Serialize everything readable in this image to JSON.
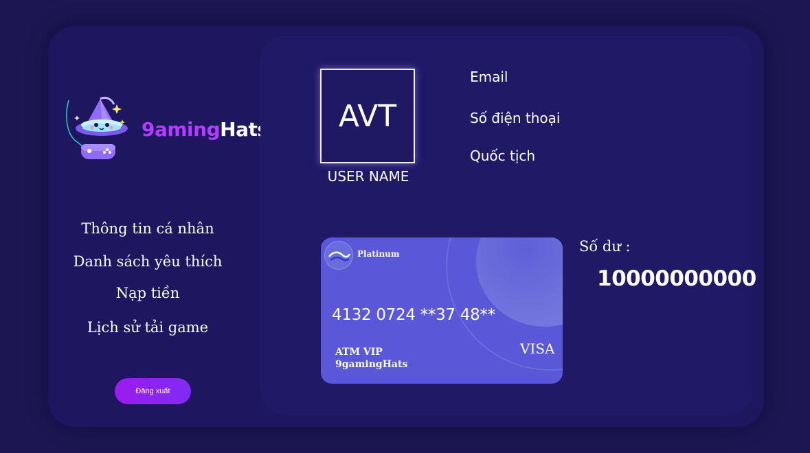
{
  "brand": {
    "logo_part1": "9aming",
    "logo_part2": "Hats"
  },
  "sidebar": {
    "menu": [
      {
        "label": "Thông tin cá nhân"
      },
      {
        "label": "Danh sách yêu thích"
      },
      {
        "label": "Nạp tiền"
      },
      {
        "label": "Lịch sử tải game"
      }
    ],
    "logout_label": "Đăng xuất"
  },
  "profile": {
    "avatar_text": "AVT",
    "username": "USER NAME",
    "email_label": "Email",
    "phone_label": "Số điện thoại",
    "nationality_label": "Quốc tịch"
  },
  "card": {
    "tier": "Platinum",
    "number": "4132 0724 **37 48**",
    "line1": "ATM VIP",
    "line2": "9gamingHats",
    "network": "VISA"
  },
  "balance": {
    "label": "Số dư :",
    "value": "10000000000"
  },
  "colors": {
    "background": "#1c1652",
    "panel": "#201966",
    "accent": "#b23cff",
    "card": "#5a57d8"
  },
  "icons": {
    "logo_mascot": "wizard-hat-icon",
    "controller": "gamepad-icon",
    "card_logo": "wave-logo-icon"
  }
}
